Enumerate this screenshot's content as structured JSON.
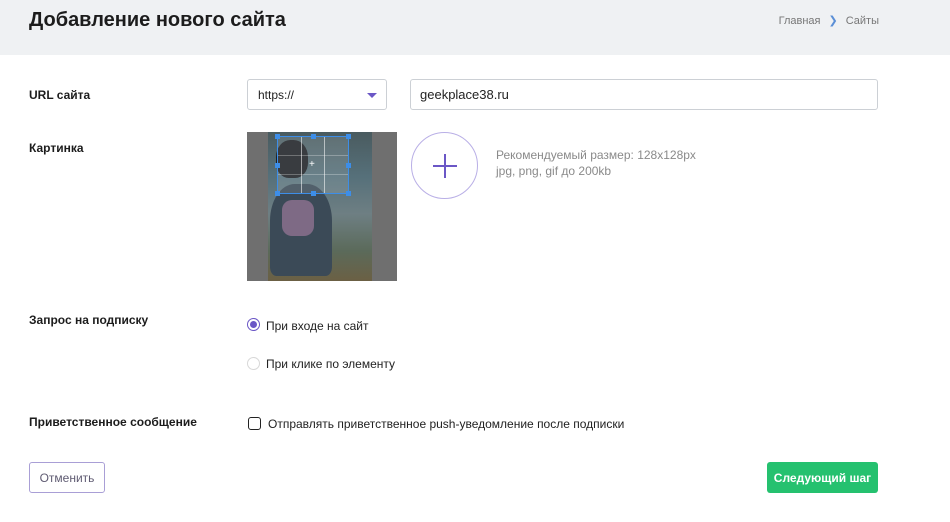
{
  "header": {
    "title": "Добавление нового сайта",
    "breadcrumb": {
      "home": "Главная",
      "current": "Сайты"
    }
  },
  "url_row": {
    "label": "URL сайта",
    "protocol_selected": "https://",
    "url_value": "geekplace38.ru"
  },
  "image_row": {
    "label": "Картинка",
    "hint_line1": "Рекомендуемый размер: 128x128px",
    "hint_line2": "jpg, png, gif до 200kb"
  },
  "subscription_row": {
    "label": "Запрос на подписку",
    "options": [
      {
        "label": "При входе на сайт",
        "checked": true
      },
      {
        "label": "При клике по элементу",
        "checked": false
      }
    ]
  },
  "welcome_row": {
    "label": "Приветственное сообщение",
    "checkbox_label": "Отправлять приветственное push-уведомление после подписки",
    "checked": false
  },
  "buttons": {
    "cancel": "Отменить",
    "next": "Следующий шаг"
  },
  "colors": {
    "accent": "#6b57c6",
    "primary_button": "#25c16f",
    "header_bg": "#eff1f3"
  }
}
